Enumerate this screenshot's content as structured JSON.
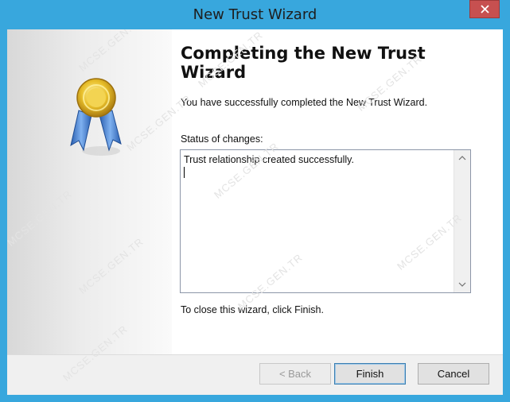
{
  "window": {
    "title": "New Trust Wizard"
  },
  "heading": "Completing the New Trust Wizard",
  "success_message": "You have successfully completed the New Trust Wizard.",
  "status": {
    "label": "Status of changes:",
    "text": "Trust relationship created successfully."
  },
  "close_message": "To close this wizard, click Finish.",
  "buttons": {
    "back": "< Back",
    "finish": "Finish",
    "cancel": "Cancel"
  },
  "watermark": "MCSE.GEN.TR",
  "colors": {
    "title_bar": "#38a7dd",
    "close_button": "#c75050",
    "default_button_border": "#3c7fb1"
  },
  "icons": {
    "wizard_graphic": "award-ribbon-icon",
    "close": "close-icon",
    "scroll_up": "chevron-up-icon",
    "scroll_down": "chevron-down-icon"
  }
}
